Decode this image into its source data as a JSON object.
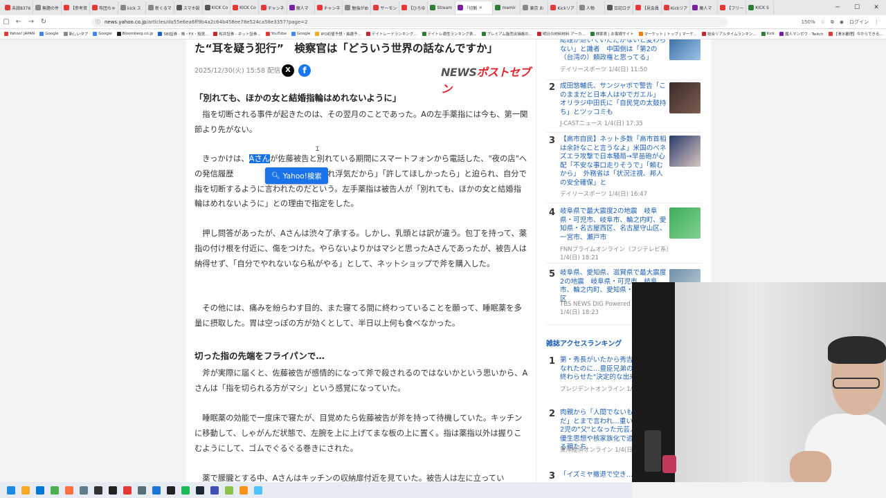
{
  "browser": {
    "tabs": [
      {
        "label": "未読8376",
        "color": "#e53935"
      },
      {
        "label": "無題の件",
        "color": "#888888"
      },
      {
        "label": "【参考資",
        "color": "#e53935"
      },
      {
        "label": "布団ちゃ",
        "color": "#e53935"
      },
      {
        "label": "kick ス",
        "color": "#888888"
      },
      {
        "label": "新くるマ",
        "color": "#888888"
      },
      {
        "label": "スマホ設",
        "color": "#555555"
      },
      {
        "label": "KICK Co",
        "color": "#555555"
      },
      {
        "label": "KICK Co",
        "color": "#e53935"
      },
      {
        "label": "チャンネ",
        "color": "#e53935"
      },
      {
        "label": "魔人マ",
        "color": "#7b1fa2"
      },
      {
        "label": "チャンネ",
        "color": "#e53935"
      },
      {
        "label": "勉強がめ",
        "color": "#888888"
      },
      {
        "label": "サーモン",
        "color": "#e53935"
      },
      {
        "label": "【ひろゆ",
        "color": "#e53935"
      },
      {
        "label": "Stream",
        "color": "#2e7d32"
      },
      {
        "label": "「切断",
        "color": "#7b1fa2",
        "active": true
      },
      {
        "label": "mamir",
        "color": "#2e7d32"
      },
      {
        "label": "東京 お",
        "color": "#888888"
      },
      {
        "label": "Kickリア",
        "color": "#e53935"
      },
      {
        "label": "人物",
        "color": "#888888"
      },
      {
        "label": "日記ログ",
        "color": "#555555"
      },
      {
        "label": "【見会員",
        "color": "#e53935"
      },
      {
        "label": "Kickリア",
        "color": "#e53935"
      },
      {
        "label": "魔人マ",
        "color": "#7b1fa2"
      },
      {
        "label": "【フリー",
        "color": "#e53935"
      },
      {
        "label": "KICK S",
        "color": "#2e7d32"
      }
    ],
    "url_host": "news.yahoo.co.jp",
    "url_path": "/articles/da55e6ea6ff9b4a2c64b458ee78e524ca58e3357?page=2",
    "zoom": "150%",
    "login_label": "ログイン",
    "bookmarks": [
      {
        "label": "Yahoo! JAPAN",
        "color": "#e53935"
      },
      {
        "label": "Google",
        "color": "#4285f4"
      },
      {
        "label": "新しいタブ",
        "color": "#888888"
      },
      {
        "label": "Google",
        "color": "#4285f4"
      },
      {
        "label": "Bloomberg.co.jp",
        "color": "#222222"
      },
      {
        "label": "SBI証券 - 株・FX・投資...",
        "color": "#1565c0"
      },
      {
        "label": "松井証券 - ネット証券...",
        "color": "#c62828"
      },
      {
        "label": "YouTube",
        "color": "#e53935"
      },
      {
        "label": "Google",
        "color": "#4285f4"
      },
      {
        "label": "IPO初値予想・抽選予...",
        "color": "#f9a825"
      },
      {
        "label": "デイトレードランキング...",
        "color": "#c62828"
      },
      {
        "label": "デイトレ適性ランキング表...",
        "color": "#2e7d32"
      },
      {
        "label": "プレミアム盤売出価格の...",
        "color": "#2e7d32"
      },
      {
        "label": "明日の材料材料 アーカ...",
        "color": "#c62828"
      },
      {
        "label": "検索表 | お客様サイト",
        "color": "#2e7d32"
      },
      {
        "label": "マーケット | トップ | マーケ...",
        "color": "#f57c00"
      },
      {
        "label": "総合リアルタイムランキン...",
        "color": "#c62828"
      },
      {
        "label": "Kick",
        "color": "#2e7d32"
      },
      {
        "label": "魔人マンボウ - Twitch",
        "color": "#7b1fa2"
      },
      {
        "label": "【滑水審理】今からできる...",
        "color": "#e53935"
      }
    ]
  },
  "article": {
    "headline": "た“耳を疑う犯行”　検察官は「どういう世界の話なんですか」",
    "date": "2025/12/30(火) 15:58 配信",
    "source_logo_a": "NEWS",
    "source_logo_b": "ポストセブン",
    "subhead1": "「別れても、ほかの女と結婚指輪はめれないように」",
    "p1": "　指を切断される事件が起きたのは、その翌月のことであった。Aの左手薬指には今も、第一関節より先がない。",
    "p2_pre": "　きっかけは、",
    "p2_sel": "Aさん",
    "p2_post": "が佐藤被告と別れている期間にスマートフォンから電話した、\"夜の店\"への発信履歴　　　　　　　　から「それ浮気だから」「許してほしかったら」と迫られ、自分で指を切断するように言われたのだという。左手薬指は被告人が「別れても、ほかの女と結婚指輪はめれないように」との理由で指定をした。",
    "p3": "　押し問答があったが、Aさんは渋々了承する。しかし、乳頭とは訳が違う。包丁を持って、薬指の付け根を付近に、傷をつけた。やらないよりかはマシと思ったAさんであったが、被告人は納得せず、「自分でやれないなら私がやる」として、ネットショップで斧を購入した。",
    "p4": "　その他には、痛みを紛らわす目的、また寝てる間に終わっていることを願って、睡眠薬を多量に摂取した。胃は空っぽの方が効くとして、半日以上何も食べなかった。",
    "subhead2": "切った指の先端をフライパンで…",
    "p5": "　斧が実際に届くと、佐藤被告が感情的になって斧で殺されるのではないかという思いから、Aさんは「指を切られる方がマシ」という感覚になっていた。",
    "p6": "　睡眠薬の効能で一度床で寝たが、目覚めたら佐藤被告が斧を持って待機していた。キッチンに移動して、しゃがんだ状態で、左腕を上に上げてまな板の上に置く。指は薬指以外は握りこむようにして、ゴムでぐるぐる巻きにされた。",
    "p7": "　薬で朦朧とする中、Aさんはキッチンの収納扉付近を見ていた。被告人は左に立ってい",
    "popup_label": "Yahoo!検索",
    "x_label": "X",
    "fb_label": "f"
  },
  "ranking": {
    "top_item": {
      "title": "総理が退いていただかないと変わらない」と識者　中国側は「第2の（台湾の）頼政権と思ってる」",
      "source": "デイリースポーツ 1/4(日) 11:50"
    },
    "items": [
      {
        "num": "2",
        "title": "成田悠輔氏、サンジャポで警告「このままだと日本人はゆでガエル」　オリラジ中田氏に「自民党の太鼓持ち」とツッコミも",
        "source": "J-CASTニュース 1/4(日) 17:35"
      },
      {
        "num": "3",
        "title": "【高市自民】ネット多数「高市首相は余計なこと言うなよ」米国のベネズエラ攻撃で日本騒局→早苗砲が心配「不安な事口走りそうで」「頼むから」　外務省は「状況注視、邦人の安全確保」と",
        "source": "デイリースポーツ 1/4(日) 16:47"
      },
      {
        "num": "4",
        "title": "岐阜県で最大震度2の地震　岐阜県・可児市、岐阜市、輪之内町、愛知県・名古屋西区、名古屋守山区、一宮市、瀬戸市",
        "source": "FNNプライムオンライン（フジテレビ系）1/4(日) 18:21"
      },
      {
        "num": "5",
        "title": "岐阜県、愛知県、滋賀県で最大震度2の地震　岐阜県・可児市、岐阜市、輪之内町、愛知県・名古屋市西区",
        "source": "TBS NEWS DIG Powered by JNN 1/4(日) 18:23"
      }
    ],
    "magazine_head": "雑誌アクセスランキング",
    "magazine_items": [
      {
        "num": "1",
        "title": "第・秀長がいたから秀吉は天下人になれたのに…豊臣兄弟の協力関係を終わらせた\"決定的な出来事\"",
        "source": "プレジデントオンライン 1/4(日) 17:15"
      },
      {
        "num": "2",
        "title": "肉親から「人間でないものが来るんだ」とまで言われ…重い障害を持つ2児の\"父\"となった元芸人が語る、優生思想や核家族化で追い詰められる親たち",
        "source": "東洋経済オンライン 1/4(日)"
      },
      {
        "num": "3",
        "title": "「イズミヤ撤退で空き…",
        "source": ""
      }
    ]
  },
  "taskbar": {
    "icons": [
      "windows-start",
      "file-explorer",
      "edge",
      "chrome",
      "firefox",
      "mail",
      "terminal",
      "obs",
      "chrome-profile",
      "calculator",
      "notepad",
      "tver",
      "spotify",
      "steam",
      "app",
      "vlc-stream",
      "bitcoin",
      "folder-app"
    ]
  }
}
